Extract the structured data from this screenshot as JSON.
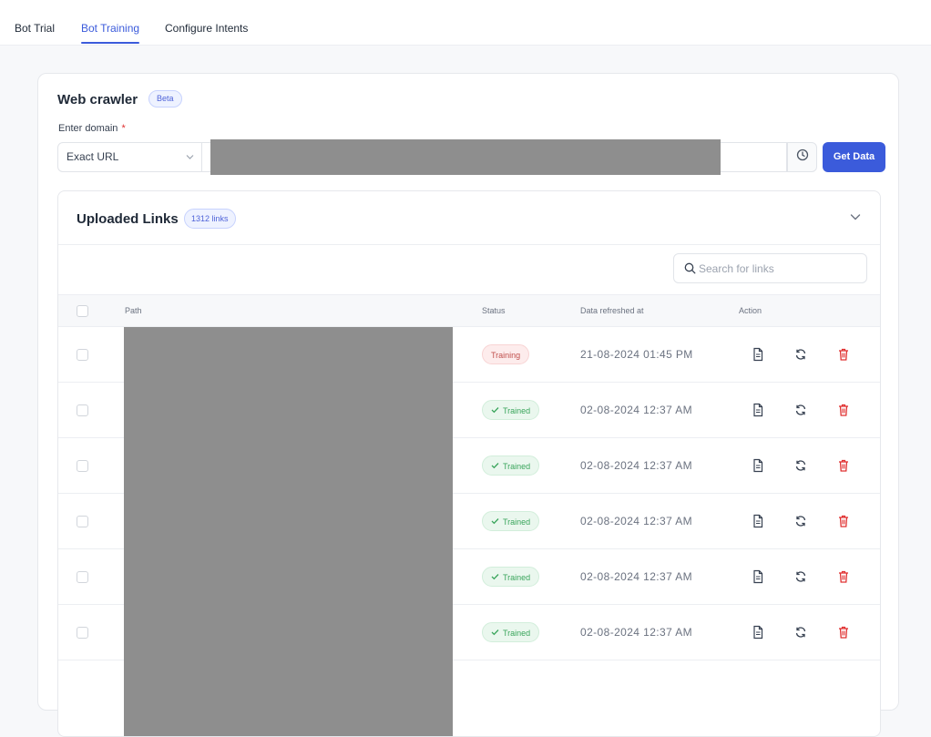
{
  "nav": {
    "tabs": [
      {
        "label": "Bot Trial",
        "active": false
      },
      {
        "label": "Bot Training",
        "active": true
      },
      {
        "label": "Configure Intents",
        "active": false
      }
    ]
  },
  "crawler": {
    "title": "Web crawler",
    "badge": "Beta",
    "domain_label": "Enter domain",
    "required_mark": "*",
    "match_type": "Exact URL",
    "get_data_label": "Get Data"
  },
  "uploaded": {
    "title": "Uploaded Links",
    "count_badge": "1312 links",
    "search_placeholder": "Search for links"
  },
  "table": {
    "headers": {
      "path": "Path",
      "status": "Status",
      "refreshed": "Data refreshed at",
      "action": "Action"
    },
    "rows": [
      {
        "status": "Training",
        "refreshed": "21-08-2024 01:45 PM"
      },
      {
        "status": "Trained",
        "refreshed": "02-08-2024 12:37 AM"
      },
      {
        "status": "Trained",
        "refreshed": "02-08-2024 12:37 AM"
      },
      {
        "status": "Trained",
        "refreshed": "02-08-2024 12:37 AM"
      },
      {
        "status": "Trained",
        "refreshed": "02-08-2024 12:37 AM"
      },
      {
        "status": "Trained",
        "refreshed": "02-08-2024 12:37 AM"
      }
    ]
  },
  "colors": {
    "accent": "#3b5bdb",
    "training": "#c0504d",
    "trained": "#3aa55c",
    "delete": "#e03131"
  },
  "icons": [
    "search-icon",
    "history-icon",
    "chevron-down-icon",
    "document-icon",
    "refresh-icon",
    "trash-icon",
    "check-icon"
  ]
}
